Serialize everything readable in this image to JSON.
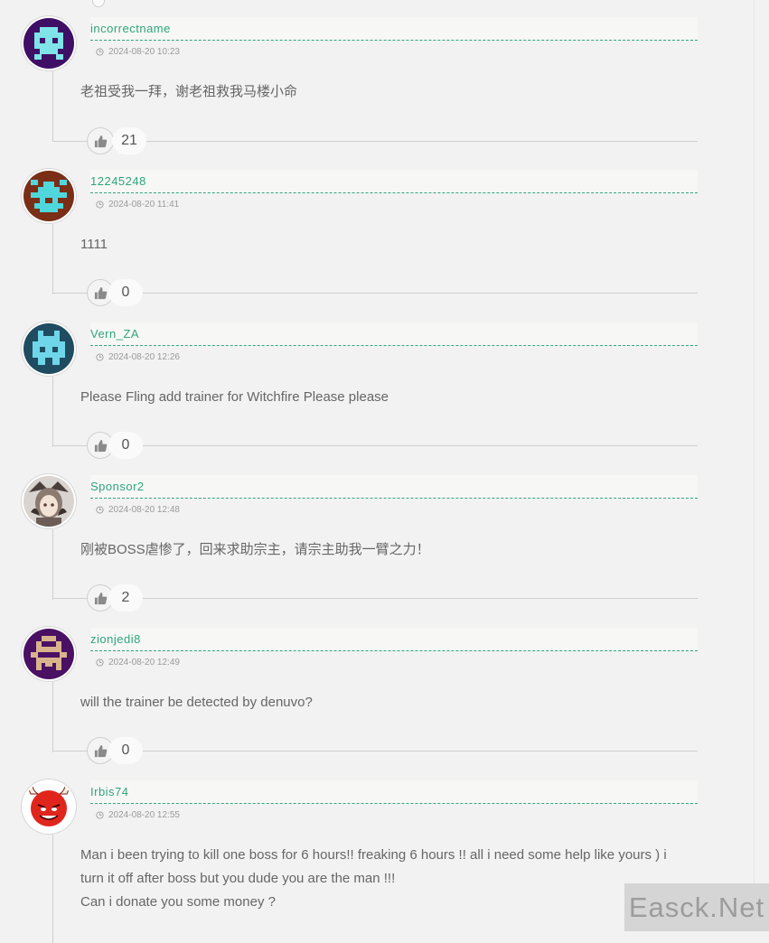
{
  "comments": [
    {
      "username": "incorrectname",
      "time": "2024-08-20 10:23",
      "text": "老祖受我一拜，谢老祖救我马楼小命",
      "likes": "21",
      "avatar_icon": "pixel-invader-avatar-icon",
      "avatar_bg": "#3f0f66",
      "avatar_fg": "#7fe3e8"
    },
    {
      "username": "12245248",
      "time": "2024-08-20 11:41",
      "text": "1111",
      "likes": "0",
      "avatar_icon": "pixel-invader-avatar-icon",
      "avatar_bg": "#7a2e16",
      "avatar_fg": "#4fd7dc"
    },
    {
      "username": "Vern_ZA",
      "time": "2024-08-20 12:26",
      "text": "Please Fling add trainer for Witchfire Please please",
      "likes": "0",
      "avatar_icon": "pixel-invader-avatar-icon",
      "avatar_bg": "#1f4c60",
      "avatar_fg": "#6fd6ea"
    },
    {
      "username": "Sponsor2",
      "time": "2024-08-20 12:48",
      "text": "刚被BOSS虐惨了，回来求助宗主，请宗主助我一臂之力！",
      "likes": "2",
      "avatar_icon": "anime-portrait-avatar-icon",
      "avatar_bg": "#d9d4cf",
      "avatar_fg": "#4a3f3a"
    },
    {
      "username": "zionjedi8",
      "time": "2024-08-20 12:49",
      "text": "will the trainer be detected by denuvo?",
      "likes": "0",
      "avatar_icon": "pixel-invader-avatar-icon",
      "avatar_bg": "#4a1063",
      "avatar_fg": "#d9b38c"
    },
    {
      "username": "Irbis74",
      "time": "2024-08-20 12:55",
      "text_lines": [
        "Man i been trying to kill one boss for 6 hours!! freaking 6 hours !! all i need some help like yours ) i",
        "turn it off after boss but you dude you are the man !!!",
        "Can i donate you some money ?"
      ],
      "avatar_icon": "red-devil-smiley-avatar-icon",
      "avatar_bg": "#e0261c",
      "avatar_fg": "#ffffff"
    }
  ],
  "watermark": "Easck.Net",
  "colors": {
    "accent": "#2fa57e",
    "background": "#f2f2f2",
    "text": "#666666",
    "meta": "#9a9a9a"
  }
}
